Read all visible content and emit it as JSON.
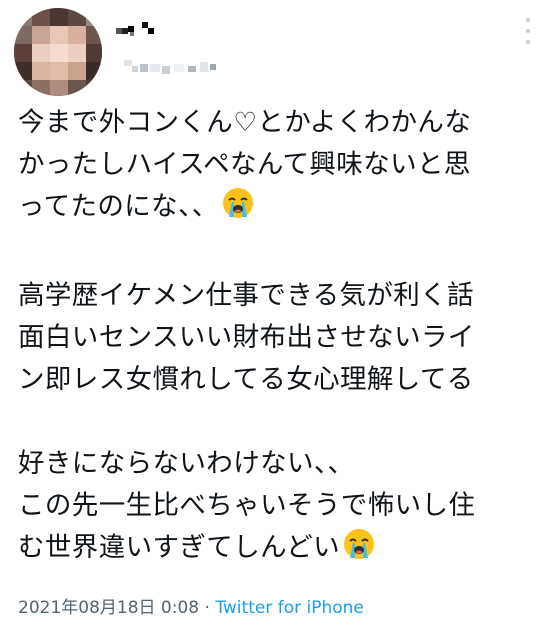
{
  "tweet": {
    "lines": [
      "今まで外コンくん♡とかよくわかんな",
      "かったしハイスペなんて興味ないと思",
      "ってたのにな、、",
      "",
      "高学歴イケメン仕事できる気が利く話",
      "面白いセンスいい財布出させないライ",
      "ン即レス女慣れしてる女心理解してる",
      "",
      "好きにならないわけない、、",
      "この先一生比べちゃいそうで怖いし住",
      "む世界違いすぎてしんどい"
    ],
    "emoji": "loudly-crying-face"
  },
  "meta": {
    "datetime": "2021年08月18日 0:08",
    "separator": " · ",
    "source": "Twitter for iPhone"
  },
  "icons": {
    "more": "more-vertical-icon"
  },
  "colors": {
    "text": "#0f1419",
    "meta": "#536471",
    "link": "#1d9bf0"
  }
}
